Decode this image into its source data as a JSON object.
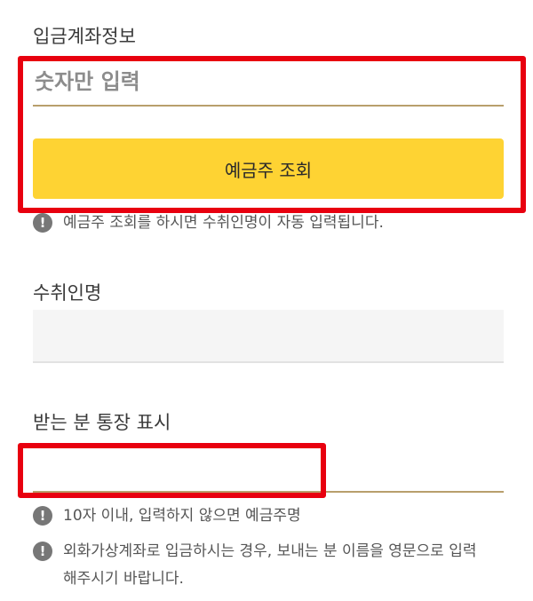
{
  "deposit_account": {
    "label": "입금계좌정보",
    "input_placeholder": "숫자만 입력",
    "lookup_button_label": "예금주 조회",
    "lookup_note": "예금주 조회를 하시면 수취인명이 자동 입력됩니다."
  },
  "recipient": {
    "label": "수취인명",
    "value": ""
  },
  "receiver_display": {
    "label": "받는 분 통장 표시",
    "input_value": "",
    "notes": [
      "10자 이내, 입력하지 않으면 예금주명",
      "외화가상계좌로 입금하시는 경우, 보내는 분 이름을 영문으로 입력해주시기 바랍니다."
    ]
  },
  "icons": {
    "info": "exclamation-circle-icon"
  },
  "colors": {
    "button": "#fed333",
    "underline": "#b89f6c",
    "highlight": "#e8000f",
    "icon": "#777777"
  }
}
